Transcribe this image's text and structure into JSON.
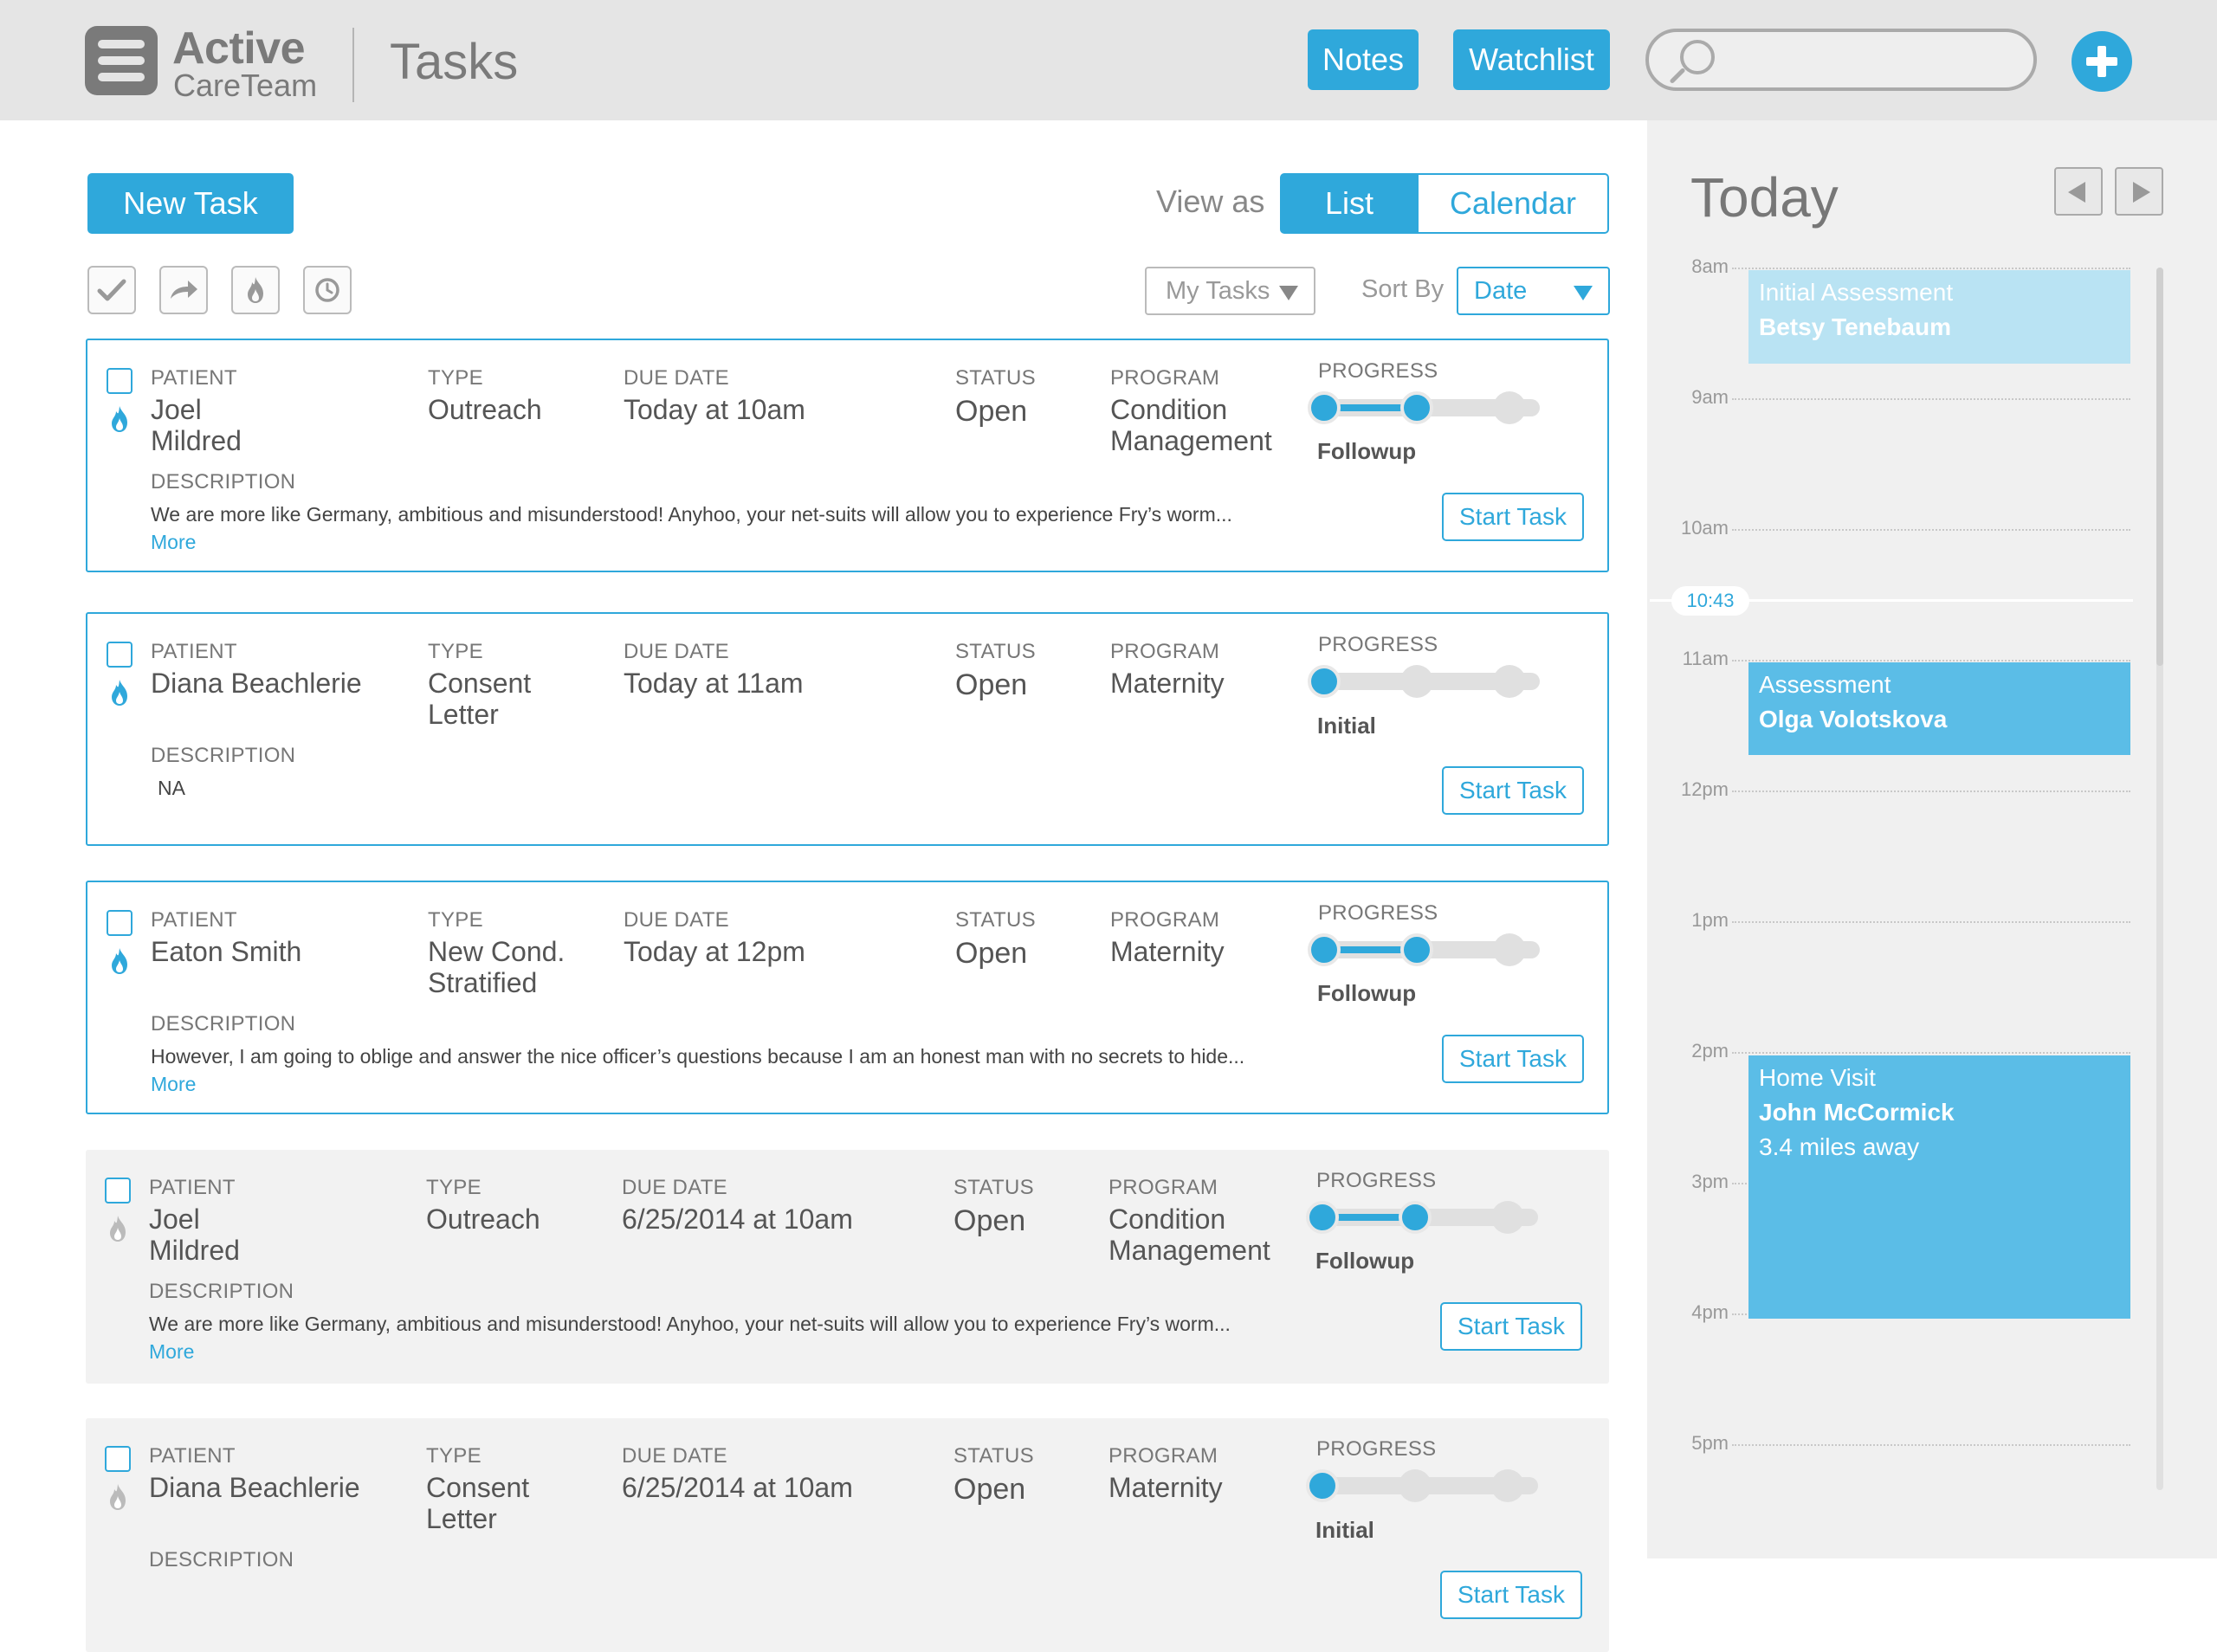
{
  "header": {
    "brand_line1": "Active",
    "brand_line2": "CareTeam",
    "title": "Tasks",
    "notes_label": "Notes",
    "watchlist_label": "Watchlist",
    "search_placeholder": ""
  },
  "toolbar": {
    "new_task_label": "New Task",
    "view_as_label": "View as",
    "view_list_label": "List",
    "view_calendar_label": "Calendar",
    "filter_value": "My Tasks",
    "sort_by_label": "Sort By",
    "sort_value": "Date",
    "action_icons": [
      "check-icon",
      "forward-icon",
      "fire-icon",
      "clock-icon"
    ]
  },
  "task_labels": {
    "patient": "PATIENT",
    "type": "TYPE",
    "due_date": "DUE DATE",
    "status": "STATUS",
    "program": "PROGRAM",
    "progress": "PROGRESS",
    "description": "DESCRIPTION",
    "more": "More",
    "start_task": "Start Task"
  },
  "tasks": [
    {
      "patient_line1": "Joel",
      "patient_line2": "Mildred",
      "type_line1": "Outreach",
      "type_line2": "",
      "due_date": "Today at 10am",
      "status": "Open",
      "program_line1": "Condition",
      "program_line2": "Management",
      "stage": "Followup",
      "progress_step": 2,
      "progress_total": 3,
      "description": "We are more like Germany, ambitious and misunderstood! Anyhoo, your net-suits will allow you to experience Fry’s worm...",
      "has_more": true,
      "active": true
    },
    {
      "patient_line1": "Diana Beachlerie",
      "patient_line2": "",
      "type_line1": "Consent",
      "type_line2": "Letter",
      "due_date": "Today at 11am",
      "status": "Open",
      "program_line1": "Maternity",
      "program_line2": "",
      "stage": "Initial",
      "progress_step": 1,
      "progress_total": 3,
      "description": "NA",
      "has_more": false,
      "active": true
    },
    {
      "patient_line1": "Eaton Smith",
      "patient_line2": "",
      "type_line1": "New Cond.",
      "type_line2": "Stratified",
      "due_date": "Today at 12pm",
      "status": "Open",
      "program_line1": "Maternity",
      "program_line2": "",
      "stage": "Followup",
      "progress_step": 2,
      "progress_total": 3,
      "description": "However, I am going to oblige and answer the nice officer’s questions because I am an honest man with no secrets to hide...",
      "has_more": true,
      "active": true
    },
    {
      "patient_line1": "Joel",
      "patient_line2": "Mildred",
      "type_line1": "Outreach",
      "type_line2": "",
      "due_date": "6/25/2014 at 10am",
      "status": "Open",
      "program_line1": "Condition",
      "program_line2": "Management",
      "stage": "Followup",
      "progress_step": 2,
      "progress_total": 3,
      "description": "We are more like Germany, ambitious and misunderstood! Anyhoo, your net-suits will allow you to experience Fry’s worm...",
      "has_more": true,
      "active": false
    },
    {
      "patient_line1": "Diana Beachlerie",
      "patient_line2": "",
      "type_line1": "Consent",
      "type_line2": "Letter",
      "due_date": "6/25/2014 at 10am",
      "status": "Open",
      "program_line1": "Maternity",
      "program_line2": "",
      "stage": "Initial",
      "progress_step": 1,
      "progress_total": 3,
      "description": "",
      "has_more": false,
      "active": false
    }
  ],
  "calendar": {
    "title": "Today",
    "now_label": "10:43",
    "hours": [
      "8am",
      "9am",
      "10am",
      "11am",
      "12pm",
      "1pm",
      "2pm",
      "3pm",
      "4pm",
      "5pm"
    ],
    "events": [
      {
        "type": "Initial Assessment",
        "patient": "Betsy Tenebaum",
        "detail": ""
      },
      {
        "type": "Assessment",
        "patient": "Olga Volotskova",
        "detail": ""
      },
      {
        "type": "Home Visit",
        "patient": "John McCormick",
        "detail": "3.4 miles away"
      }
    ]
  },
  "colors": {
    "accent": "#2fa8db",
    "header_bg": "#e5e5e5",
    "sidebar_bg": "#f0f0f0",
    "past_card_bg": "#f2f2f2",
    "event_bg": "#5bbde7",
    "event_light_bg": "#b9e3f3"
  }
}
